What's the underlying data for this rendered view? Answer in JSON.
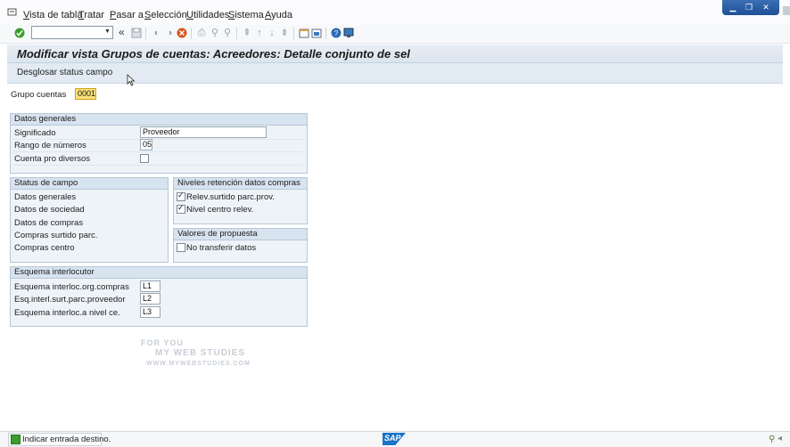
{
  "menu": {
    "items": [
      {
        "label": "Vista de tabla",
        "hotkey": "V"
      },
      {
        "label": "Tratar",
        "hotkey": "T"
      },
      {
        "label": "Pasar a",
        "hotkey": "P"
      },
      {
        "label": "Selección",
        "hotkey": "S"
      },
      {
        "label": "Utilidades",
        "hotkey": "U"
      },
      {
        "label": "Sistema",
        "hotkey": "S"
      },
      {
        "label": "Ayuda",
        "hotkey": "A"
      }
    ]
  },
  "toolbar": {
    "command_value": "",
    "collapse_glyph": "«"
  },
  "title": "Modificar vista Grupos de cuentas: Acreedores: Detalle conjunto de sel",
  "app_toolbar": {
    "button_label": "Desglosar status campo"
  },
  "grupo_cuentas": {
    "label": "Grupo cuentas",
    "value": "0001"
  },
  "datos_generales": {
    "header": "Datos generales",
    "significado": {
      "label": "Significado",
      "value": "Proveedor"
    },
    "rango": {
      "label": "Rango de números",
      "value": "05"
    },
    "cuenta_diversos": {
      "label": "Cuenta pro diversos",
      "checked": false
    }
  },
  "status_campo": {
    "header": "Status de campo",
    "items": [
      "Datos generales",
      "Datos de sociedad",
      "Datos de compras",
      "Compras surtido parc.",
      "Compras centro"
    ]
  },
  "niveles": {
    "header": "Niveles retención datos compras",
    "items": [
      {
        "label": "Relev.surtido parc.prov.",
        "checked": true
      },
      {
        "label": "Nivel centro relev.",
        "checked": true
      }
    ]
  },
  "valores": {
    "header": "Valores de propuesta",
    "items": [
      {
        "label": "No transferir datos",
        "checked": false
      }
    ]
  },
  "esquema": {
    "header": "Esquema interlocutor",
    "rows": [
      {
        "label": "Esquema interloc.org.compras",
        "value": "L1"
      },
      {
        "label": "Esq.interl.surt.parc.proveedor",
        "value": "L2"
      },
      {
        "label": "Esquema interloc.a nivel ce.",
        "value": "L3"
      }
    ]
  },
  "status_bar": {
    "message": "Indicar entrada destino.",
    "brand": "SAP"
  },
  "watermark": {
    "line1": "FOR YOU",
    "line2": "MY WEB STUDIES",
    "line3": "WWW.MYWEBSTUDIES.COM"
  },
  "colors": {
    "title_bg": "#dbe4ee",
    "group_bg": "#eef3f8",
    "group_header": "#d7e3ef",
    "field_highlight": "#fbe27a",
    "sap_blue": "#1a74c6"
  }
}
